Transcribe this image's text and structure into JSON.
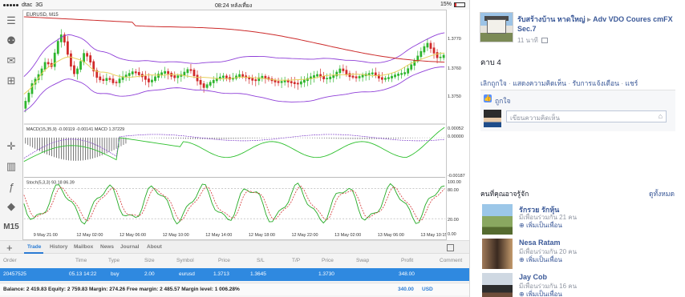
{
  "statusbar": {
    "carrier": "dtac",
    "network": "3G",
    "time": "08:24 หลังเที่ยง",
    "battery": "15%"
  },
  "chart": {
    "symbol": "EURUSD, M15",
    "price_labels": [
      "1.3770",
      "1.3760",
      "1.3750"
    ],
    "macd_label": "MACD(15,35,9) -0.00119 -0.00141 MACD 1.37229",
    "macd_labels": [
      "0.00052",
      "0.00000",
      "-0.00187"
    ],
    "stoch_label": "Stoch(5,3,3) 93.18 86.39",
    "stoch_labels": [
      "100.00",
      "80.00",
      "20.00",
      "0.00"
    ],
    "time_labels": [
      "9 May 21:00",
      "12 May 02:00",
      "12 May 06:00",
      "12 May 10:00",
      "12 May 14:00",
      "12 May 18:00",
      "12 May 22:00",
      "13 May 02:00",
      "13 May 06:00",
      "13 May 10:15"
    ],
    "colors": {
      "bull": "#2db52d",
      "bear": "#d12a2a",
      "ma_red": "#cc2a2a",
      "bands": "#8f3fd8",
      "ma_yellow": "#e8d05a",
      "macd_signal": "#2bbf2b",
      "stoch_main": "#22a922",
      "stoch_signal": "#d33333"
    }
  },
  "toolbar": {
    "icons": [
      "menu-icon",
      "user-icon",
      "chat-icon",
      "add-chart-icon",
      "crosshair-icon",
      "candlestick-icon",
      "indicator-icon",
      "objects-icon"
    ],
    "timeframe": "M15"
  },
  "tabs": [
    "Trade",
    "History",
    "Mailbox",
    "News",
    "Journal",
    "About"
  ],
  "orders": {
    "headers": [
      "Order",
      "Time",
      "Type",
      "Size",
      "Symbol",
      "Price",
      "S/L",
      "T/P",
      "Price",
      "Swap",
      "Profit",
      "Comment"
    ],
    "row": [
      "20457525",
      "05.13 14:22",
      "buy",
      "2.00",
      "eurusd",
      "1.3713",
      "1.3645",
      "",
      "1.3730",
      "",
      "348.00",
      ""
    ]
  },
  "balance": {
    "text": "Balance: 2 419.83 Equity: 2 759.83 Margin: 274.26 Free margin: 2 485.57 Margin level: 1 006.28%",
    "profit": "340.00",
    "currency": "USD"
  },
  "fb": {
    "post_title": "รับสร้างบ้าน หาดใหญ่",
    "post_arrow": "▸",
    "post_target": "Adv VDO Coures cmFX Sec.7",
    "post_time": "11 นาที",
    "post_body": "คาบ 4",
    "actions": [
      "เลิกถูกใจ",
      "แสดงความคิดเห็น",
      "รับการแจ้งเตือน",
      "แชร์"
    ],
    "liked": "ถูกใจ",
    "comment_placeholder": "เขียนความคิดเห็น",
    "pymk_title": "คนที่คุณอาจรู้จัก",
    "pymk_all": "ดูทั้งหมด",
    "people": [
      {
        "name": "รักรวย รักหุ้น",
        "mutual": "มีเพื่อนร่วมกัน 21 คน",
        "action": "เพิ่มเป็นเพื่อน"
      },
      {
        "name": "Nesa Ratam",
        "mutual": "มีเพื่อนร่วมกัน 20 คน",
        "action": "เพิ่มเป็นเพื่อน"
      },
      {
        "name": "Jay Cob",
        "mutual": "มีเพื่อนร่วมกัน 16 คน",
        "action": "เพิ่มเป็นเพื่อน"
      }
    ]
  }
}
